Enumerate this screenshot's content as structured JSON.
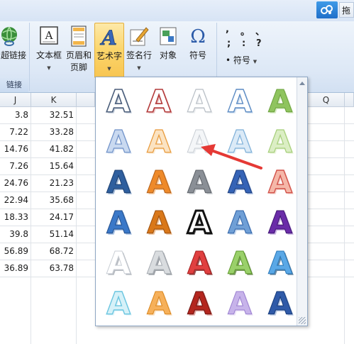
{
  "topbar": {
    "cut_label": "拖",
    "share_icon": "cloud-share-icon"
  },
  "ribbon": {
    "link_button": "超链接",
    "link_group_label": "链接",
    "textbox_button": "文本框",
    "header_footer_line1": "页眉和",
    "header_footer_line2": "页脚",
    "wordart_button": "艺术字",
    "signature_button": "签名行",
    "object_button": "对象",
    "symbol_button": "符号",
    "symbol_menu_label": "符号",
    "symbol_glyphs": [
      ",",
      "。",
      "、",
      ";",
      ":",
      "?"
    ],
    "symbol_bullet": "•",
    "caret": "▼"
  },
  "sheet": {
    "col_j": "J",
    "col_k": "K",
    "col_q": "Q",
    "rows": [
      [
        "3.8",
        "32.51"
      ],
      [
        "7.22",
        "33.28"
      ],
      [
        "14.76",
        "41.82"
      ],
      [
        "7.26",
        "15.64"
      ],
      [
        "24.76",
        "21.23"
      ],
      [
        "22.94",
        "35.68"
      ],
      [
        "18.33",
        "24.17"
      ],
      [
        "39.8",
        "51.14"
      ],
      [
        "56.89",
        "68.72"
      ],
      [
        "36.89",
        "63.78"
      ]
    ]
  },
  "wordart": {
    "letter": "A",
    "styles": [
      [
        "outline-navy",
        "outline-red",
        "outline-gray",
        "outline-blue",
        "outline-green"
      ],
      [
        "soft-blue",
        "soft-orange",
        "soft-white",
        "soft-teal",
        "soft-lime"
      ],
      [
        "bevel-blue",
        "bevel-orange",
        "bevel-silver",
        "bevel-navy",
        "bevel-salmon"
      ],
      [
        "gradient-blue",
        "gradient-amber",
        "black-outline",
        "gradient-skyblue",
        "gradient-purple"
      ],
      [
        "white-shadow",
        "gray-shadow",
        "red-shadow",
        "green-shadow",
        "blue-shadow"
      ],
      [
        "glow-cyan",
        "glow-orange",
        "deep-red",
        "lavender",
        "navy-reflect"
      ]
    ]
  },
  "colors": {
    "ribbon_active": "#fbd56a",
    "annotation_arrow": "#e53935"
  }
}
